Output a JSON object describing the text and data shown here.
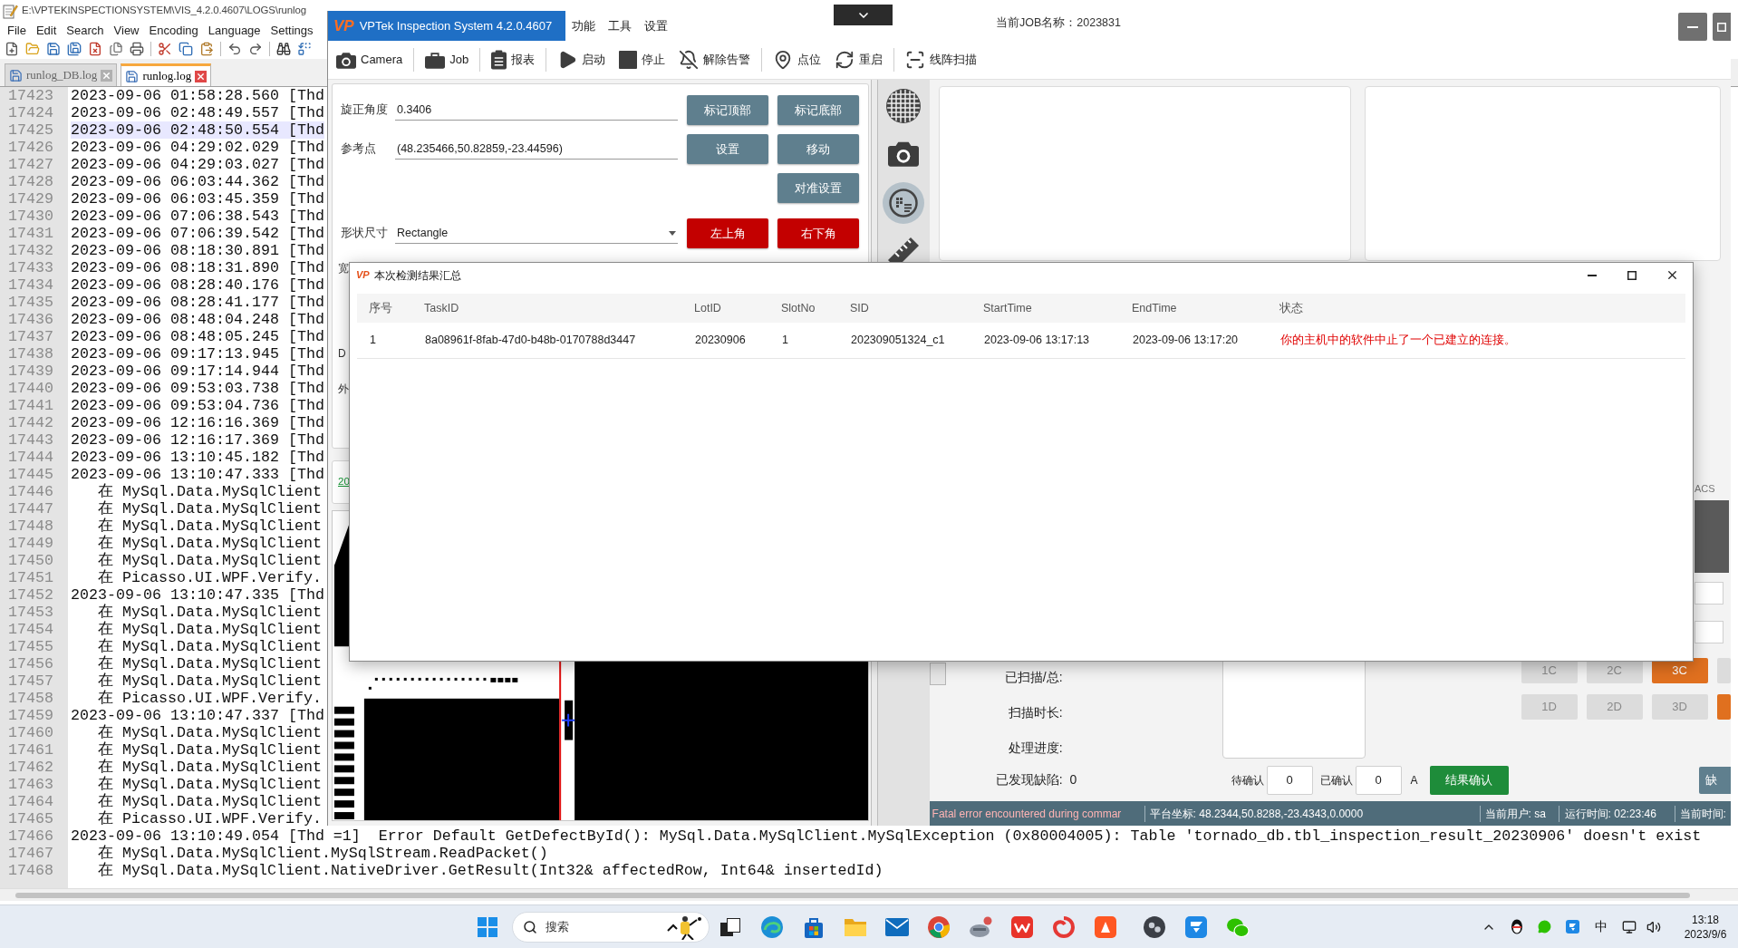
{
  "notepad": {
    "title": "E:\\VPTEKINSPECTIONSYSTEM\\VIS_4.2.0.4607\\LOGS\\runlog",
    "menu": [
      "File",
      "Edit",
      "Search",
      "View",
      "Encoding",
      "Language",
      "Settings"
    ],
    "tabs": [
      {
        "label": "runlog_DB.log",
        "selected": false
      },
      {
        "label": "runlog.log",
        "selected": true
      }
    ],
    "lines": [
      {
        "number": "17423",
        "text": "2023-09-06 01:58:28.560 [Thd",
        "current": false
      },
      {
        "number": "17424",
        "text": "2023-09-06 02:48:49.557 [Thd",
        "current": false
      },
      {
        "number": "17425",
        "text": "2023-09-06 02:48:50.554 [Thd",
        "current": true
      },
      {
        "number": "17426",
        "text": "2023-09-06 04:29:02.029 [Thd",
        "current": false
      },
      {
        "number": "17427",
        "text": "2023-09-06 04:29:03.027 [Thd",
        "current": false
      },
      {
        "number": "17428",
        "text": "2023-09-06 06:03:44.362 [Thd",
        "current": false
      },
      {
        "number": "17429",
        "text": "2023-09-06 06:03:45.359 [Thd",
        "current": false
      },
      {
        "number": "17430",
        "text": "2023-09-06 07:06:38.543 [Thd",
        "current": false
      },
      {
        "number": "17431",
        "text": "2023-09-06 07:06:39.542 [Thd",
        "current": false
      },
      {
        "number": "17432",
        "text": "2023-09-06 08:18:30.891 [Thd",
        "current": false
      },
      {
        "number": "17433",
        "text": "2023-09-06 08:18:31.890 [Thd",
        "current": false
      },
      {
        "number": "17434",
        "text": "2023-09-06 08:28:40.176 [Thd",
        "current": false
      },
      {
        "number": "17435",
        "text": "2023-09-06 08:28:41.177 [Thd",
        "current": false
      },
      {
        "number": "17436",
        "text": "2023-09-06 08:48:04.248 [Thd",
        "current": false
      },
      {
        "number": "17437",
        "text": "2023-09-06 08:48:05.245 [Thd",
        "current": false
      },
      {
        "number": "17438",
        "text": "2023-09-06 09:17:13.945 [Thd",
        "current": false
      },
      {
        "number": "17439",
        "text": "2023-09-06 09:17:14.944 [Thd",
        "current": false
      },
      {
        "number": "17440",
        "text": "2023-09-06 09:53:03.738 [Thd",
        "current": false
      },
      {
        "number": "17441",
        "text": "2023-09-06 09:53:04.736 [Thd",
        "current": false
      },
      {
        "number": "17442",
        "text": "2023-09-06 12:16:16.369 [Thd",
        "current": false
      },
      {
        "number": "17443",
        "text": "2023-09-06 12:16:17.369 [Thd",
        "current": false
      },
      {
        "number": "17444",
        "text": "2023-09-06 13:10:45.182 [Thd",
        "current": false
      },
      {
        "number": "17445",
        "text": "2023-09-06 13:10:47.333 [Thd",
        "current": false
      },
      {
        "number": "17446",
        "text": "   在 MySql.Data.MySqlClient",
        "current": false
      },
      {
        "number": "17447",
        "text": "   在 MySql.Data.MySqlClient",
        "current": false
      },
      {
        "number": "17448",
        "text": "   在 MySql.Data.MySqlClient",
        "current": false
      },
      {
        "number": "17449",
        "text": "   在 MySql.Data.MySqlClient",
        "current": false
      },
      {
        "number": "17450",
        "text": "   在 MySql.Data.MySqlClient",
        "current": false
      },
      {
        "number": "17451",
        "text": "   在 Picasso.UI.WPF.Verify.",
        "current": false
      },
      {
        "number": "17452",
        "text": "2023-09-06 13:10:47.335 [Thd",
        "current": false
      },
      {
        "number": "17453",
        "text": "   在 MySql.Data.MySqlClient",
        "current": false
      },
      {
        "number": "17454",
        "text": "   在 MySql.Data.MySqlClient",
        "current": false
      },
      {
        "number": "17455",
        "text": "   在 MySql.Data.MySqlClient",
        "current": false
      },
      {
        "number": "17456",
        "text": "   在 MySql.Data.MySqlClient",
        "current": false
      },
      {
        "number": "17457",
        "text": "   在 MySql.Data.MySqlClient",
        "current": false
      },
      {
        "number": "17458",
        "text": "   在 Picasso.UI.WPF.Verify.",
        "current": false
      },
      {
        "number": "17459",
        "text": "2023-09-06 13:10:47.337 [Thd",
        "current": false
      },
      {
        "number": "17460",
        "text": "   在 MySql.Data.MySqlClient",
        "current": false
      },
      {
        "number": "17461",
        "text": "   在 MySql.Data.MySqlClient",
        "current": false
      },
      {
        "number": "17462",
        "text": "   在 MySql.Data.MySqlClient",
        "current": false
      },
      {
        "number": "17463",
        "text": "   在 MySql.Data.MySqlClient",
        "current": false
      },
      {
        "number": "17464",
        "text": "   在 MySql.Data.MySqlClient",
        "current": false
      },
      {
        "number": "17465",
        "text": "   在 Picasso.UI.WPF.Verify.",
        "current": false
      },
      {
        "number": "17466",
        "text": "2023-09-06 13:10:49.054 [Thd =1]  Error Default GetDefectById(): MySql.Data.MySqlClient.MySqlException (0x80004005): Table 'tornado_db.tbl_inspection_result_20230906' doesn't exist",
        "current": false
      },
      {
        "number": "17467",
        "text": "   在 MySql.Data.MySqlClient.MySqlStream.ReadPacket()",
        "current": false
      },
      {
        "number": "17468",
        "text": "   在 MySql.Data.MySqlClient.NativeDriver.GetResult(Int32& affectedRow, Int64& insertedId)",
        "current": false
      }
    ]
  },
  "app": {
    "logo": "VP",
    "title": "VPTek Inspection System 4.2.0.4607",
    "menu": [
      "功能",
      "工具",
      "设置"
    ],
    "job": "当前JOB名称：2023831",
    "toolbar_groups": [
      [
        {
          "kind": "camera",
          "label": "Camera"
        }
      ],
      [
        {
          "kind": "job",
          "label": "Job"
        }
      ],
      [
        {
          "kind": "report",
          "label": "报表"
        }
      ],
      [
        {
          "kind": "start",
          "label": "启动"
        },
        {
          "kind": "stop",
          "label": "停止"
        },
        {
          "kind": "alarm_off",
          "label": "解除告警"
        }
      ],
      [
        {
          "kind": "point",
          "label": "点位"
        },
        {
          "kind": "restart",
          "label": "重启"
        }
      ],
      [
        {
          "kind": "scan",
          "label": "线阵扫描"
        }
      ]
    ],
    "form": {
      "rows": [
        {
          "field": {
            "kind": "text",
            "label": "旋正角度",
            "value": "0.3406"
          },
          "buttons": [
            {
              "label": "标记顶部",
              "kind": "normal"
            },
            {
              "label": "标记底部",
              "kind": "normal"
            }
          ]
        },
        {
          "field": {
            "kind": "text",
            "label": "参考点",
            "value": "(48.235466,50.82859,-23.44596)"
          },
          "buttons": [
            {
              "label": "设置",
              "kind": "normal"
            },
            {
              "label": "移动",
              "kind": "normal"
            }
          ]
        },
        {
          "buttons": [
            {
              "label": "对准设置",
              "kind": "normal"
            }
          ]
        },
        {
          "field": {
            "kind": "dropdown",
            "label": "形状尺寸",
            "value": "Rectangle"
          },
          "buttons": [
            {
              "label": "左上角",
              "kind": "danger"
            },
            {
              "label": "右下角",
              "kind": "danger"
            }
          ]
        }
      ],
      "cut_labels": [
        "宽",
        "D",
        "外"
      ]
    },
    "link": "20",
    "tools": [
      {
        "kind": "grid",
        "selected": false
      },
      {
        "kind": "camera",
        "selected": false
      },
      {
        "kind": "map",
        "selected": true
      },
      {
        "kind": "ruler",
        "selected": false
      }
    ],
    "side_label": "ACS",
    "stats": [
      "已扫描/总:",
      "扫描时长:",
      "处理进度:"
    ],
    "defects": {
      "label": "已发现缺陷:",
      "value": "0"
    },
    "confirm": {
      "pending_label": "待确认",
      "pending": "0",
      "confirmed_label": "已确认",
      "confirmed": "0",
      "unit": "A",
      "button": "结果确认"
    },
    "slots": [
      {
        "label": "1C",
        "selected": false
      },
      {
        "label": "2C",
        "selected": false
      },
      {
        "label": "3C",
        "selected": true
      },
      {
        "selected": false
      },
      {
        "label": "1D",
        "selected": false
      },
      {
        "label": "2D",
        "selected": false
      },
      {
        "label": "3D",
        "selected": false
      },
      {
        "selected": true
      }
    ],
    "side_button": "缺",
    "status": {
      "error": "Fatal error encountered during commar",
      "coordinates": "平台坐标: 48.2344,50.8288,-23.4343,0.0000",
      "user": "当前用户: sa",
      "runtime": "运行时间: 02:23:46",
      "time": "当前时间:"
    }
  },
  "dialog": {
    "icon": "VP",
    "title": "本次检测结果汇总",
    "columns": [
      "序号",
      "TaskID",
      "LotID",
      "SlotNo",
      "SID",
      "StartTime",
      "EndTime",
      "状态"
    ],
    "rows": [
      [
        "1",
        "8a08961f-8fab-47d0-b48b-0170788d3447",
        "20230906",
        "1",
        "202309051324_c1",
        "2023-09-06 13:17:13",
        "2023-09-06 13:17:20",
        "你的主机中的软件中止了一个已建立的连接。"
      ]
    ]
  },
  "taskbar": {
    "search_placeholder": "搜索",
    "ime": "中",
    "time": "13:18",
    "date": "2023/9/6"
  }
}
